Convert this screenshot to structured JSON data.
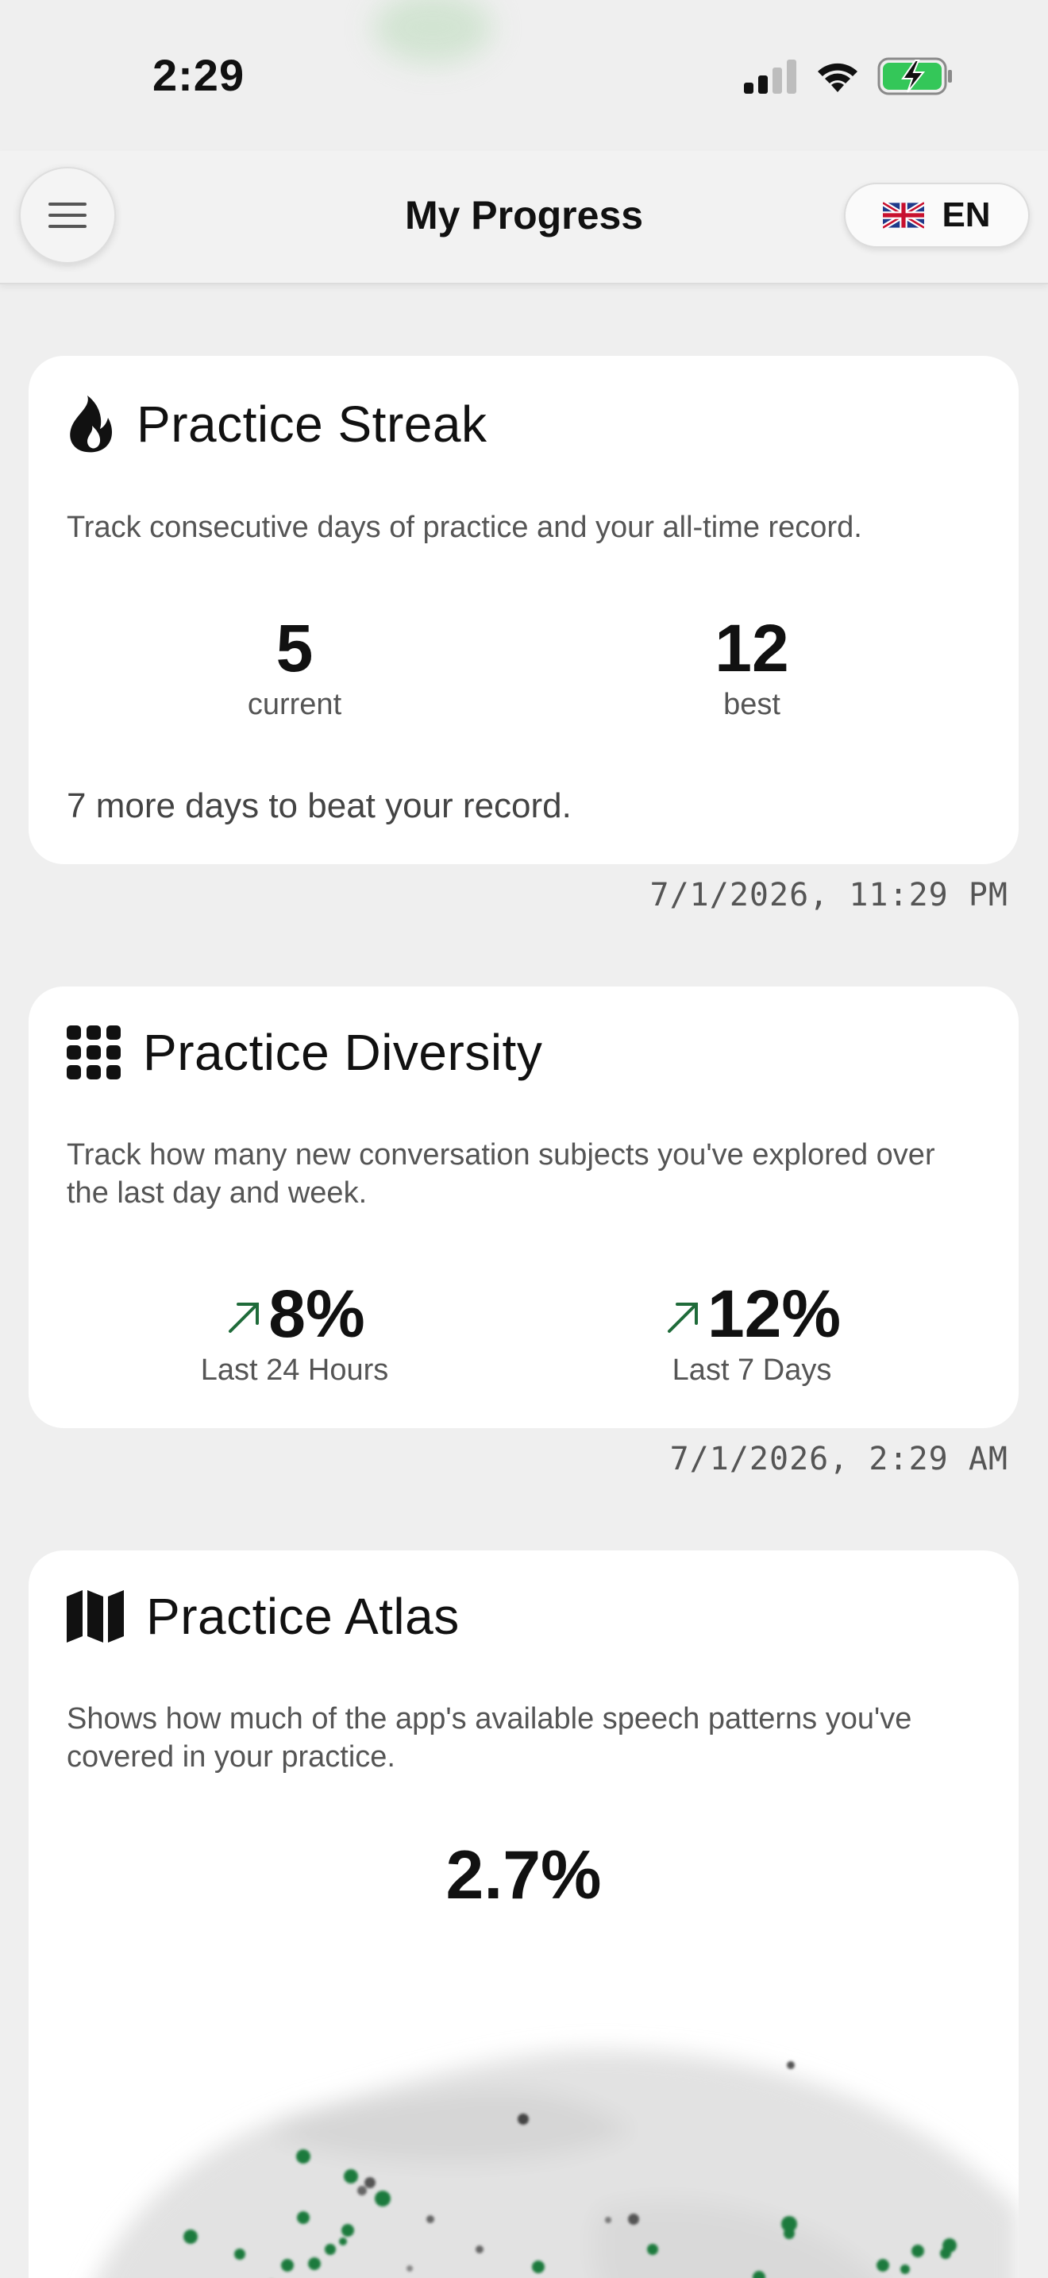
{
  "status_bar": {
    "time": "2:29",
    "icons": [
      "cellular-signal-icon",
      "wifi-icon",
      "battery-charging-icon"
    ]
  },
  "header": {
    "title": "My Progress",
    "language": "EN",
    "menu_icon": "hamburger-menu-icon",
    "flag_icon": "uk-flag-icon"
  },
  "streak": {
    "icon": "flame-icon",
    "title": "Practice Streak",
    "description": "Track consecutive days of practice and your all-time record.",
    "current_value": "5",
    "current_label": "current",
    "best_value": "12",
    "best_label": "best",
    "note": "7 more days to beat your record.",
    "timestamp": "7/1/2026, 11:29 PM"
  },
  "diversity": {
    "icon": "grid-icon",
    "title": "Practice Diversity",
    "description": "Track how many new conversation subjects you've explored over the last day and week.",
    "day_value": "8%",
    "day_label": "Last 24 Hours",
    "week_value": "12%",
    "week_label": "Last 7 Days",
    "trend_icon": "arrow-up-right-icon",
    "timestamp": "7/1/2026, 2:29 AM"
  },
  "atlas": {
    "icon": "map-icon",
    "title": "Practice Atlas",
    "description": "Shows how much of the app's available speech patterns you've covered in your practice.",
    "coverage": "2.7%"
  },
  "colors": {
    "accent_green": "#1f6b3a",
    "dot_green": "#1e7a3c",
    "card_bg": "#ffffff",
    "page_bg": "#efefef"
  }
}
